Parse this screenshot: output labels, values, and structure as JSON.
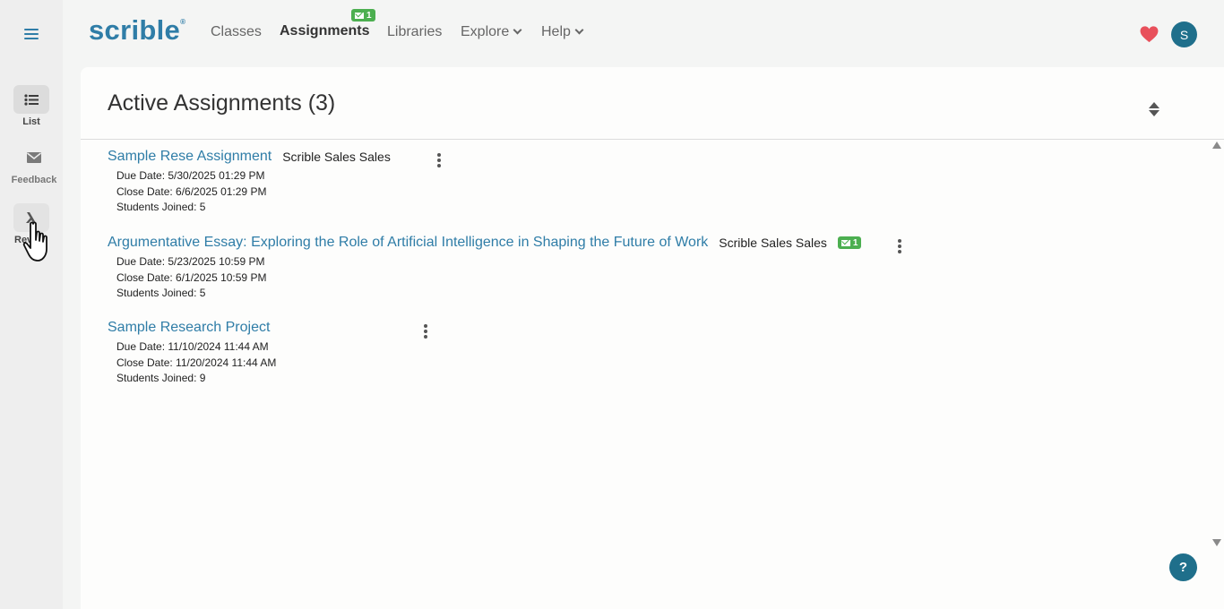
{
  "app": {
    "logo": "scrible",
    "logo_mark": "®"
  },
  "nav": {
    "items": [
      {
        "label": "Classes"
      },
      {
        "label": "Assignments",
        "badge_count": "1"
      },
      {
        "label": "Libraries"
      },
      {
        "label": "Explore"
      },
      {
        "label": "Help"
      }
    ],
    "avatar_initial": "S"
  },
  "rail": {
    "items": [
      {
        "label": "List",
        "icon": "list-icon"
      },
      {
        "label": "Feedback",
        "icon": "envelope-icon"
      },
      {
        "label": "Rev",
        "icon": "lambda-icon"
      }
    ]
  },
  "main": {
    "title": "Active Assignments (3)",
    "assignments": [
      {
        "title": "Sample Rese Assignment",
        "class": "Scrible Sales Sales",
        "due": "Due Date: 5/30/2025 01:29 PM",
        "close": "Close Date: 6/6/2025 01:29 PM",
        "joined": "Students Joined: 5"
      },
      {
        "title": "Argumentative Essay: Exploring the Role of Artificial Intelligence in Shaping the Future of Work",
        "class": "Scrible Sales Sales",
        "badge_count": "1",
        "due": "Due Date: 5/23/2025 10:59 PM",
        "close": "Close Date: 6/1/2025 10:59 PM",
        "joined": "Students Joined: 5"
      },
      {
        "title": "Sample Research Project",
        "class": "",
        "due": "Due Date: 11/10/2024 11:44 AM",
        "close": "Close Date: 11/20/2024 11:44 AM",
        "joined": "Students Joined: 9"
      }
    ]
  },
  "help": {
    "label": "?"
  },
  "colors": {
    "accent": "#2f7da7",
    "avatar": "#1f6f8b",
    "badge": "#4caf50",
    "heart": "#e8505b"
  }
}
